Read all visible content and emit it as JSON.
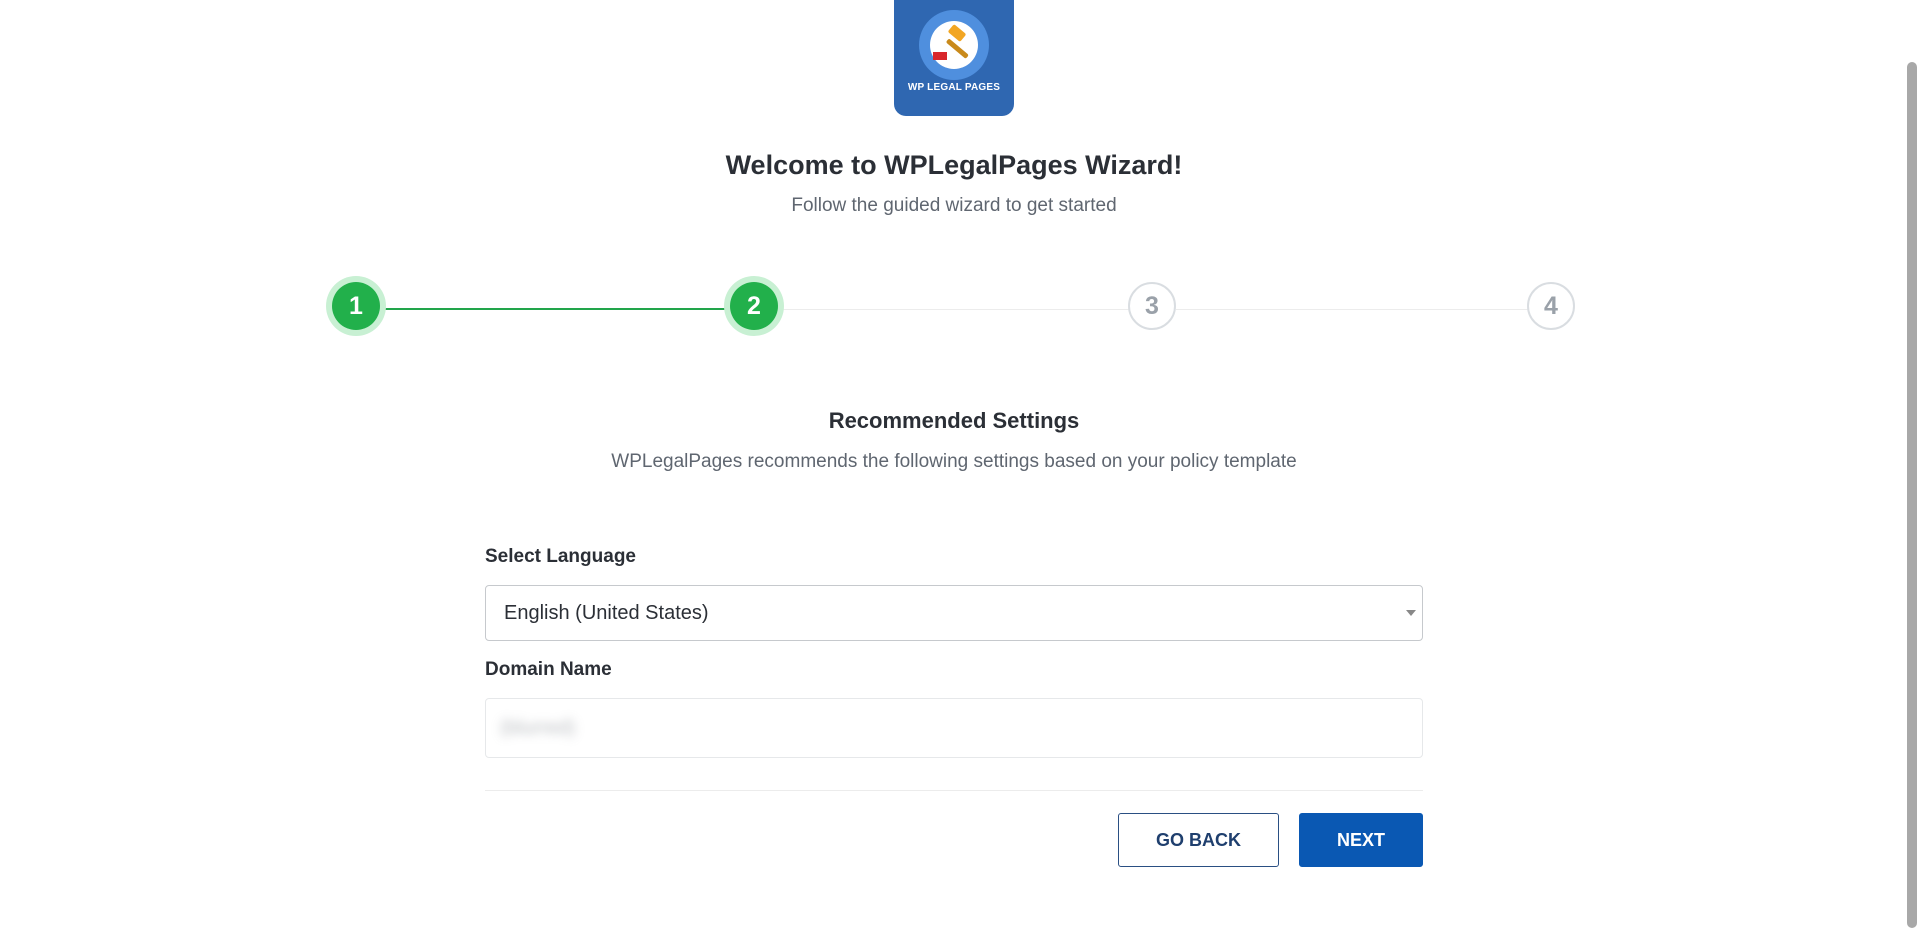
{
  "logo": {
    "text": "WP LEGAL PAGES",
    "icon": "gavel-icon"
  },
  "header": {
    "title": "Welcome to WPLegalPages Wizard!",
    "subtitle": "Follow the guided wizard to get started"
  },
  "stepper": {
    "steps": [
      {
        "label": "1",
        "state": "complete"
      },
      {
        "label": "2",
        "state": "current"
      },
      {
        "label": "3",
        "state": "upcoming"
      },
      {
        "label": "4",
        "state": "upcoming"
      }
    ],
    "active_color": "#22b04b"
  },
  "section": {
    "title": "Recommended Settings",
    "description": "WPLegalPages recommends the following settings based on your policy template"
  },
  "form": {
    "language_label": "Select Language",
    "language_value": "English (United States)",
    "domain_label": "Domain Name",
    "domain_value": "(blurred)"
  },
  "actions": {
    "back_label": "GO BACK",
    "next_label": "NEXT",
    "next_color": "#0a58b3"
  }
}
